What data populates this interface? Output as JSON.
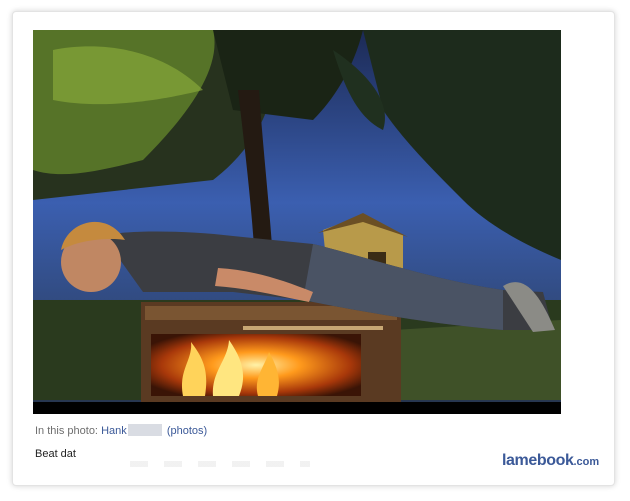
{
  "photo": {
    "description_icon": "photo-of-person-planking-over-grill-icon"
  },
  "caption": {
    "prefix": "In this photo:",
    "tagged_name": "Hank",
    "photos_link": "(photos)"
  },
  "post": {
    "text": "Beat dat"
  },
  "watermark": {
    "name": "lamebook",
    "domain": ".com"
  },
  "colors": {
    "link": "#3b5998",
    "caption_text": "#6e6e6e",
    "redaction": "#d9dce3"
  }
}
